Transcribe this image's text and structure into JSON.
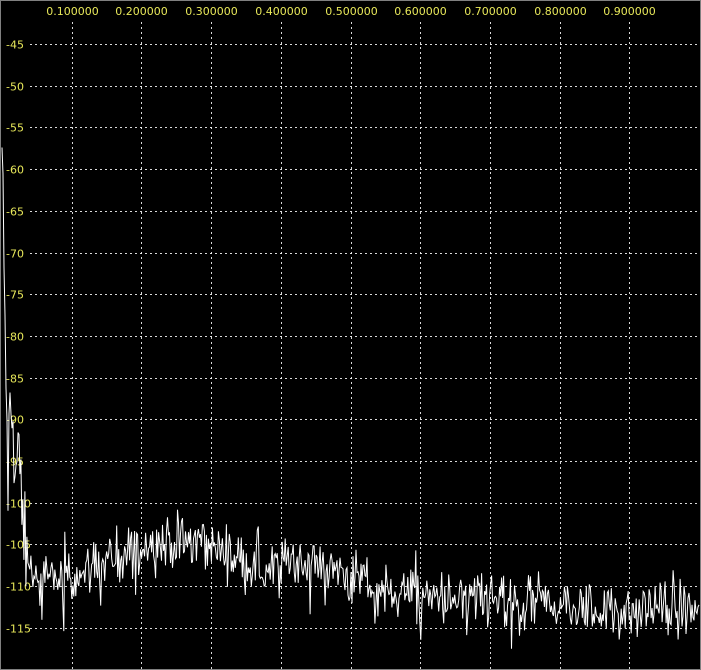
{
  "chart_data": {
    "type": "line",
    "title": "",
    "xlabel": "",
    "ylabel": "",
    "xlim": [
      0.0,
      1.0
    ],
    "ylim": [
      -117.5,
      -42
    ],
    "grid": true,
    "x_ticks": [
      0.1,
      0.2,
      0.3,
      0.4,
      0.5,
      0.6,
      0.7,
      0.8,
      0.9
    ],
    "x_tick_labels": [
      "0.100000",
      "0.200000",
      "0.300000",
      "0.400000",
      "0.500000",
      "0.600000",
      "0.700000",
      "0.800000",
      "0.900000"
    ],
    "y_ticks": [
      -45,
      -50,
      -55,
      -60,
      -65,
      -70,
      -75,
      -80,
      -85,
      -90,
      -95,
      -100,
      -105,
      -110,
      -115
    ],
    "y_tick_labels": [
      "-45",
      "-50",
      "-55",
      "-60",
      "-65",
      "-70",
      "-75",
      "-80",
      "-85",
      "-90",
      "-95",
      "-100",
      "-105",
      "-110",
      "-115"
    ],
    "colors": {
      "background": "#000000",
      "grid": "#ffffff",
      "tick_text": "#e8e85a",
      "series": "#ffffff",
      "border": "#808080"
    },
    "series": [
      {
        "name": "",
        "anchors_x": [
          0.0,
          0.004,
          0.008,
          0.012,
          0.016,
          0.02,
          0.024,
          0.028,
          0.032,
          0.036,
          0.04,
          0.05,
          0.06,
          0.08,
          0.1,
          0.12,
          0.14,
          0.16,
          0.18,
          0.2,
          0.22,
          0.24,
          0.26,
          0.28,
          0.3,
          0.32,
          0.34,
          0.36,
          0.38,
          0.4,
          0.42,
          0.44,
          0.46,
          0.48,
          0.5,
          0.52,
          0.54,
          0.56,
          0.58,
          0.6,
          0.62,
          0.64,
          0.66,
          0.68,
          0.7,
          0.72,
          0.74,
          0.76,
          0.78,
          0.8,
          0.82,
          0.84,
          0.86,
          0.88,
          0.9,
          0.92,
          0.94,
          0.96,
          0.98,
          1.0
        ],
        "anchors_y": [
          -53,
          -78,
          -98,
          -88,
          -92,
          -99,
          -90,
          -100,
          -104,
          -106,
          -108,
          -110,
          -109.5,
          -109,
          -108.5,
          -108,
          -107,
          -106.5,
          -106,
          -105.5,
          -105,
          -105,
          -104.5,
          -104.5,
          -105,
          -106,
          -107,
          -107.5,
          -108,
          -107.5,
          -107,
          -107.5,
          -108,
          -108.5,
          -109,
          -109.5,
          -110,
          -110.5,
          -110.5,
          -111,
          -111,
          -111.5,
          -111.5,
          -112,
          -112,
          -112,
          -112.5,
          -112.5,
          -112,
          -112.5,
          -112.5,
          -113,
          -113,
          -113,
          -113,
          -113,
          -112.5,
          -113,
          -113,
          -113
        ],
        "noise_amplitude": 3.5,
        "point_count": 700
      }
    ]
  }
}
